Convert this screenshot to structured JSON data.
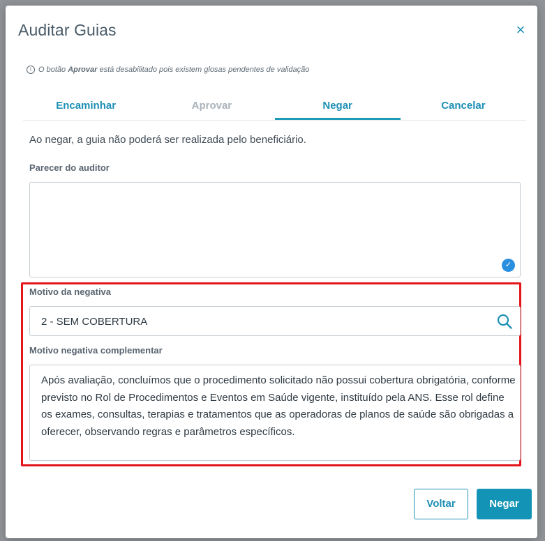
{
  "modal": {
    "title": "Auditar Guias",
    "close_label": "×"
  },
  "info_note": {
    "prefix": "O botão ",
    "emphasis": "Aprovar",
    "suffix": " está desabilitado pois existem glosas pendentes de validação"
  },
  "tabs": [
    {
      "label": "Encaminhar",
      "state": "enabled"
    },
    {
      "label": "Aprovar",
      "state": "disabled"
    },
    {
      "label": "Negar",
      "state": "active"
    },
    {
      "label": "Cancelar",
      "state": "enabled"
    }
  ],
  "form": {
    "intro": "Ao negar, a guia não poderá ser realizada pelo beneficiário.",
    "parecer_label": "Parecer do auditor",
    "parecer_value": "",
    "motivo_label": "Motivo da negativa",
    "motivo_value": "2 - SEM COBERTURA",
    "complementar_label": "Motivo negativa complementar",
    "complementar_value": "Após avaliação, concluímos que o procedimento solicitado não possui cobertura obrigatória, conforme previsto no Rol de Procedimentos e Eventos em Saúde vigente, instituído pela ANS. Esse rol define os exames, consultas, terapias e tratamentos que as operadoras de planos de saúde são obrigadas a oferecer, observando regras e parâmetros específicos."
  },
  "buttons": {
    "back": "Voltar",
    "deny": "Negar"
  },
  "colors": {
    "accent": "#1e8fb5",
    "highlight": "#e4141b",
    "primary_button": "#1394b6"
  },
  "icons": {
    "close": "close-icon",
    "info": "info-icon",
    "check": "check-circle-icon",
    "search": "search-icon"
  }
}
